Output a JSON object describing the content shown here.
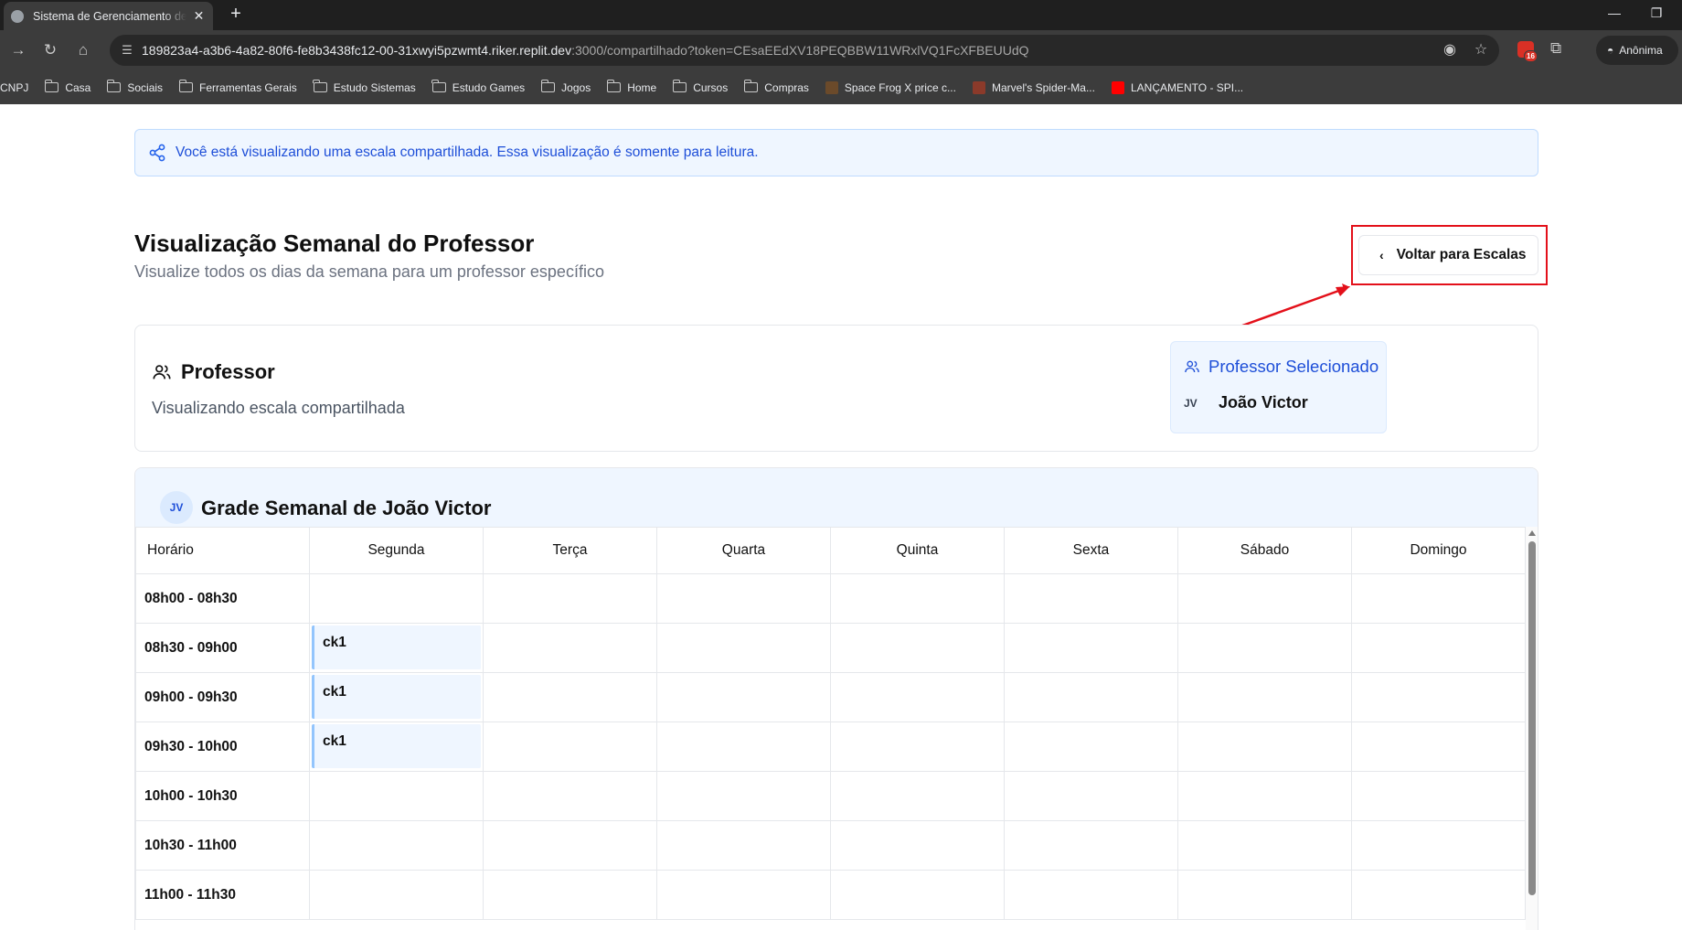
{
  "browser": {
    "tab_title": "Sistema de Gerenciamento de Escalas",
    "close_glyph": "✕",
    "new_tab_glyph": "+",
    "url_host": "189823a4-a3b6-4a82-80f6-fe8b3438fc12-00-31xwyi5pzwmt4.riker.replit.dev",
    "url_path": ":3000/compartilhado?token=CEsaEEdXV18PEQBBW11WRxlVQ1FcXFBEUUdQ",
    "extension_badge": "16",
    "profile_label": "Anônima",
    "bookmarks": [
      {
        "label": "CNPJ",
        "icon": "none"
      },
      {
        "label": "Casa",
        "icon": "folder-icon"
      },
      {
        "label": "Sociais",
        "icon": "folder-icon"
      },
      {
        "label": "Ferramentas Gerais",
        "icon": "folder-icon"
      },
      {
        "label": "Estudo Sistemas",
        "icon": "folder-icon"
      },
      {
        "label": "Estudo Games",
        "icon": "folder-icon"
      },
      {
        "label": "Jogos",
        "icon": "folder-icon"
      },
      {
        "label": "Home",
        "icon": "folder-icon"
      },
      {
        "label": "Cursos",
        "icon": "folder-icon"
      },
      {
        "label": "Compras",
        "icon": "folder-icon"
      },
      {
        "label": "Space Frog X price c...",
        "icon": "frog-favicon"
      },
      {
        "label": "Marvel's Spider-Ma...",
        "icon": "spiderman-favicon"
      },
      {
        "label": "LANÇAMENTO - SPI...",
        "icon": "youtube-favicon"
      }
    ]
  },
  "banner": {
    "text": "Você está visualizando uma escala compartilhada. Essa visualização é somente para leitura."
  },
  "header": {
    "title": "Visualização Semanal do Professor",
    "subtitle": "Visualize todos os dias da semana para um professor específico",
    "back_button": "Voltar para Escalas"
  },
  "professor_card": {
    "title": "Professor",
    "subtitle": "Visualizando escala compartilhada",
    "selected_title": "Professor Selecionado",
    "selected_initials": "JV",
    "selected_name": "João Victor"
  },
  "grade": {
    "avatar_initials": "JV",
    "title": "Grade Semanal de João Victor",
    "columns": [
      "Horário",
      "Segunda",
      "Terça",
      "Quarta",
      "Quinta",
      "Sexta",
      "Sábado",
      "Domingo"
    ],
    "rows": [
      {
        "time": "08h00 - 08h30",
        "cells": [
          "",
          "",
          "",
          "",
          "",
          "",
          ""
        ]
      },
      {
        "time": "08h30 - 09h00",
        "cells": [
          "ck1",
          "",
          "",
          "",
          "",
          "",
          ""
        ]
      },
      {
        "time": "09h00 - 09h30",
        "cells": [
          "ck1",
          "",
          "",
          "",
          "",
          "",
          ""
        ]
      },
      {
        "time": "09h30 - 10h00",
        "cells": [
          "ck1",
          "",
          "",
          "",
          "",
          "",
          ""
        ]
      },
      {
        "time": "10h00 - 10h30",
        "cells": [
          "",
          "",
          "",
          "",
          "",
          "",
          ""
        ]
      },
      {
        "time": "10h30 - 11h00",
        "cells": [
          "",
          "",
          "",
          "",
          "",
          "",
          ""
        ]
      },
      {
        "time": "11h00 - 11h30",
        "cells": [
          "",
          "",
          "",
          "",
          "",
          "",
          ""
        ]
      }
    ]
  },
  "colors": {
    "accent": "#1d4ed8",
    "annotation": "#e3101a"
  }
}
